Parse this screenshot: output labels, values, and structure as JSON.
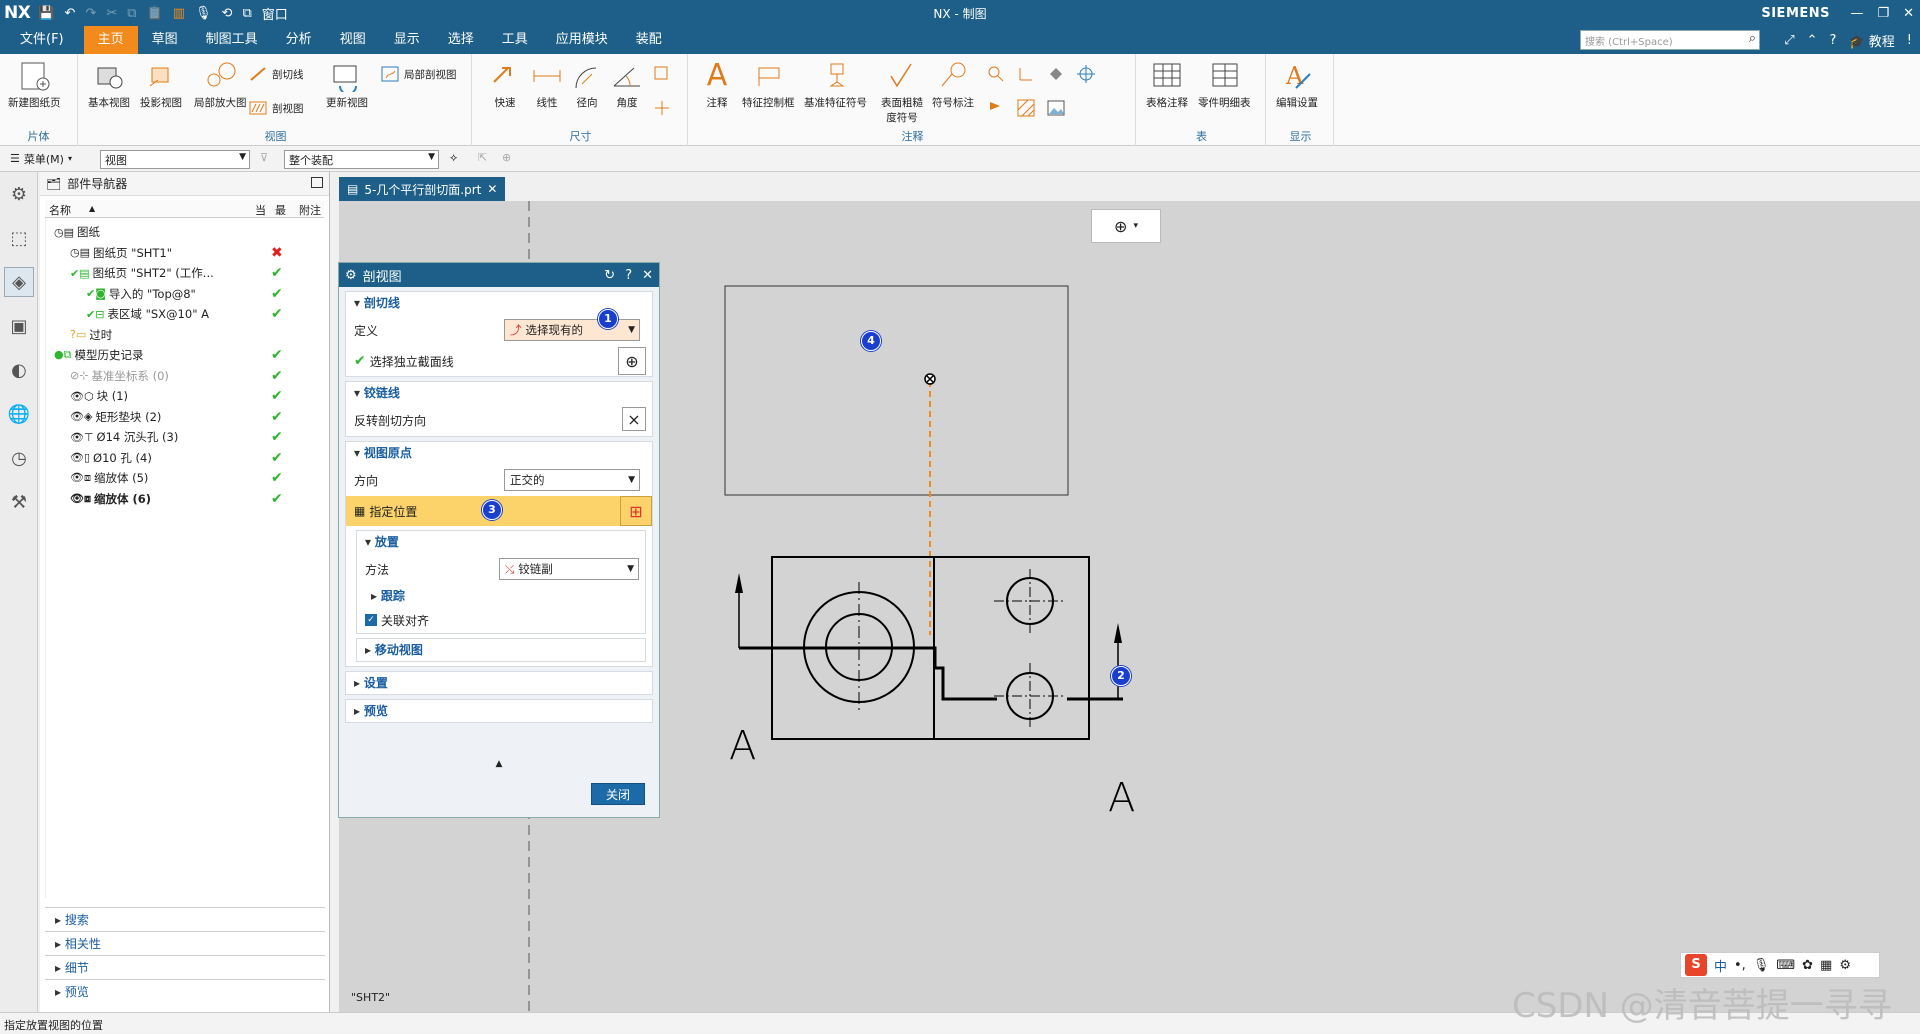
{
  "titlebar": {
    "logo": "NX",
    "title": "NX - 制图",
    "brand": "SIEMENS",
    "window_menu": "窗口"
  },
  "menubar": {
    "tabs": [
      "文件(F)",
      "主页",
      "草图",
      "制图工具",
      "分析",
      "视图",
      "显示",
      "选择",
      "工具",
      "应用模块",
      "装配"
    ],
    "active_tab": "主页",
    "search_placeholder": "搜索 (Ctrl+Space)",
    "tutorial": "教程"
  },
  "ribbon": {
    "sheet": {
      "new_sheet": "新建图纸页",
      "group": "片体"
    },
    "view": {
      "base_view": "基本视图",
      "projected_view": "投影视图",
      "detail_view": "局部放大图",
      "section_line": "剖切线",
      "section_view": "剖视图",
      "update_view": "更新视图",
      "break_out": "局部剖视图",
      "group": "视图"
    },
    "dimension": {
      "rapid": "快速",
      "linear": "线性",
      "radial": "径向",
      "angular": "角度",
      "group": "尺寸"
    },
    "annotation": {
      "note": "注释",
      "fcf": "特征控制框",
      "datum": "基准特征符号",
      "surface": "表面粗糙度符号",
      "symbol": "符号标注",
      "group": "注释"
    },
    "table": {
      "tabular_note": "表格注释",
      "parts_list": "零件明细表",
      "group": "表"
    },
    "display": {
      "edit_settings": "编辑设置",
      "group": "显示"
    }
  },
  "selbar": {
    "menu": "菜单(M)",
    "filter": "视图",
    "scope": "整个装配"
  },
  "leftstrip": {
    "icons": [
      "settings-icon",
      "assembly-icon",
      "part-navigator-icon",
      "reuse-icon",
      "history-icon",
      "web-icon",
      "clock-icon",
      "tools-icon"
    ]
  },
  "navigator": {
    "title": "部件导航器",
    "columns": {
      "name": "名称",
      "current": "当",
      "latest": "最",
      "note": "附注"
    },
    "rows": [
      {
        "label": "图纸",
        "indent": 0,
        "status": ""
      },
      {
        "label": "图纸页 \"SHT1\"",
        "indent": 1,
        "status": "bad"
      },
      {
        "label": "图纸页 \"SHT2\" (工作...",
        "indent": 1,
        "status": "ok"
      },
      {
        "label": "导入的 \"Top@8\"",
        "indent": 2,
        "status": "ok"
      },
      {
        "label": "表区域 \"SX@10\" A",
        "indent": 2,
        "status": "ok"
      },
      {
        "label": "过时",
        "indent": 1,
        "status": ""
      },
      {
        "label": "模型历史记录",
        "indent": 0,
        "status": "ok"
      },
      {
        "label": "基准坐标系 (0)",
        "indent": 1,
        "status": "ok"
      },
      {
        "label": "块 (1)",
        "indent": 1,
        "status": "ok"
      },
      {
        "label": "矩形垫块 (2)",
        "indent": 1,
        "status": "ok"
      },
      {
        "label": "Ø14 沉头孔 (3)",
        "indent": 1,
        "status": "ok"
      },
      {
        "label": "Ø10 孔 (4)",
        "indent": 1,
        "status": "ok"
      },
      {
        "label": "缩放体 (5)",
        "indent": 1,
        "status": "ok"
      },
      {
        "label": "缩放体 (6)",
        "indent": 1,
        "status": "ok"
      }
    ],
    "sections": [
      "搜索",
      "相关性",
      "细节",
      "预览"
    ]
  },
  "document": {
    "tab": "5-几个平行剖切面.prt",
    "sheet_label": "\"SHT2\""
  },
  "dialog": {
    "title": "剖视图",
    "section_line": {
      "title": "剖切线",
      "define_label": "定义",
      "define_value": "选择现有的",
      "select_label": "选择独立截面线"
    },
    "hinge_line": {
      "title": "铰链线",
      "reverse_label": "反转剖切方向"
    },
    "view_origin": {
      "title": "视图原点",
      "orientation_label": "方向",
      "orientation_value": "正交的",
      "specify_location": "指定位置",
      "placement": {
        "title": "放置",
        "method_label": "方法",
        "method_value": "铰链副",
        "tracking": "跟踪",
        "associative_align": "关联对齐"
      },
      "move_view": "移动视图"
    },
    "settings": "设置",
    "preview": "预览",
    "close_button": "关闭"
  },
  "drawing": {
    "section_label_left": "A",
    "section_label_right": "A"
  },
  "badges": [
    "1",
    "2",
    "3",
    "4"
  ],
  "statusbar": {
    "message": "指定放置视图的位置"
  },
  "ime": {
    "logo": "S",
    "lang": "中"
  },
  "watermark": "CSDN @清音菩提一寻寻"
}
